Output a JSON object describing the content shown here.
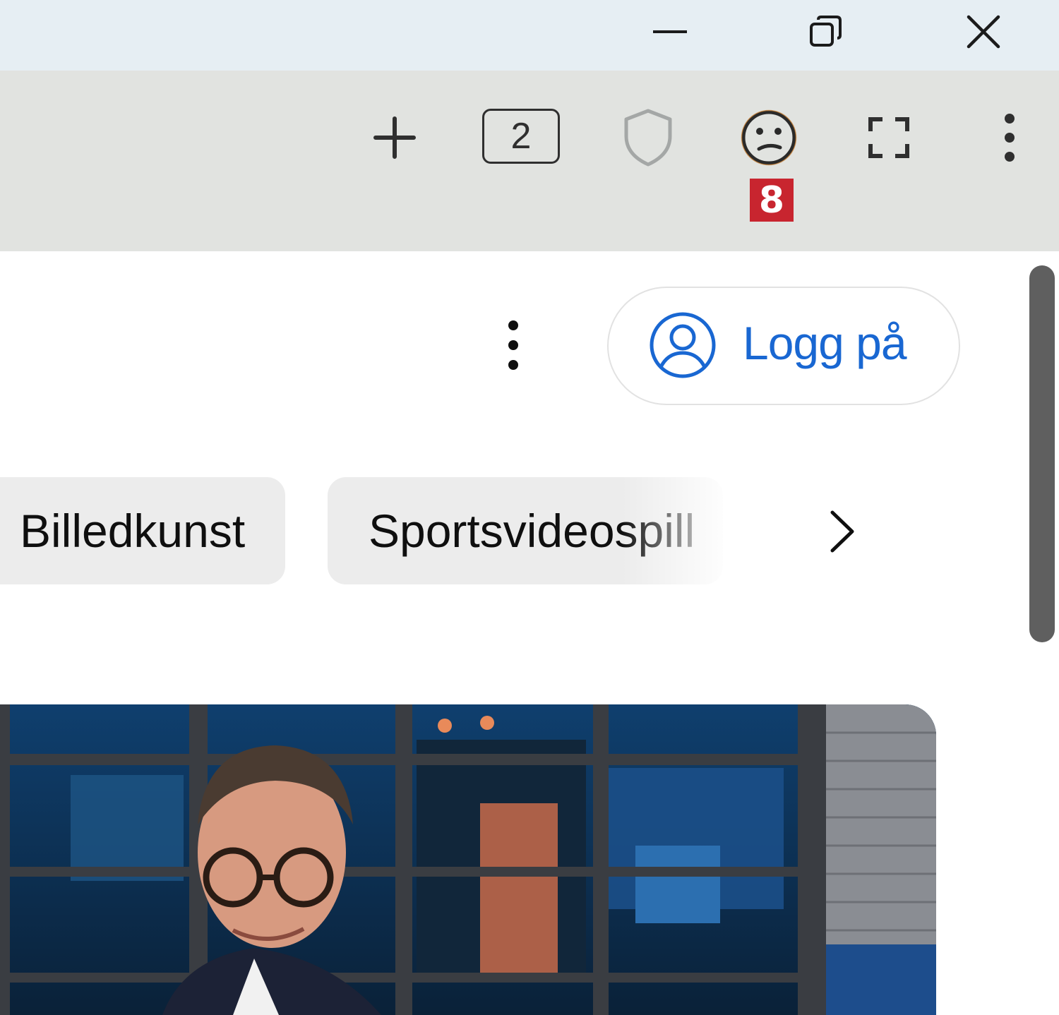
{
  "window": {
    "controls": [
      "minimize",
      "restore",
      "close"
    ]
  },
  "toolbar": {
    "tab_count": "2",
    "extension_badge": "8",
    "icons": [
      "plus-icon",
      "tab-count",
      "shield-icon",
      "confused-face-icon",
      "fullscreen-icon",
      "kebab-icon"
    ]
  },
  "header": {
    "signin_label": "Logg på"
  },
  "chips": [
    {
      "label": "Billedkunst"
    },
    {
      "label": "Sportsvideospill"
    }
  ],
  "colors": {
    "titlebar": "#e6eef3",
    "toolbar": "#e1e3e0",
    "accent": "#1967d2",
    "badge": "#c8252f",
    "chip_bg": "#ececec"
  }
}
